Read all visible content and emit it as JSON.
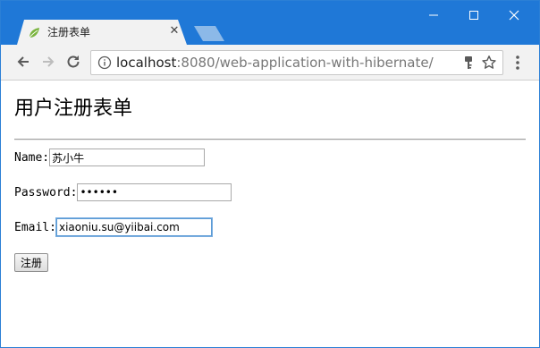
{
  "browser": {
    "tab": {
      "title": "注册表单",
      "favicon": "spring-leaf-icon",
      "close_label": "✕"
    },
    "window_controls": [
      "minimize-icon",
      "maximize-icon",
      "close-icon"
    ],
    "toolbar": {
      "url_host": "localhost",
      "url_rest": ":8080/web-application-with-hibernate/"
    },
    "colors": {
      "titlebar": "#1f78d7",
      "tab": "#f2f2f2",
      "favicon": "#7ab43f"
    }
  },
  "page": {
    "title": "用户注册表单",
    "form": {
      "name_label": "Name:",
      "name_value": "苏小牛",
      "password_label": "Password:",
      "password_value": "••••••",
      "email_label": "Email:",
      "email_value": "xiaoniu.su@yiibai.com",
      "submit_label": "注册"
    }
  }
}
